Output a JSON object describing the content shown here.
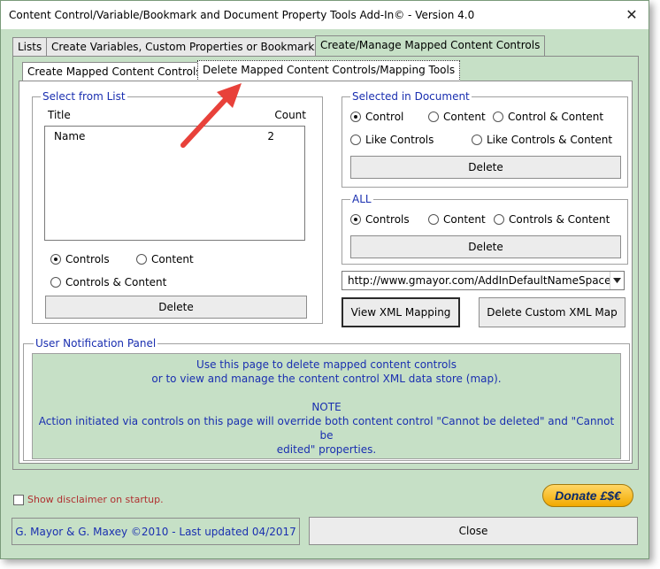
{
  "window": {
    "title": "Content Control/Variable/Bookmark and Document Property Tools Add-In© - Version 4.0",
    "close_glyph": "✕"
  },
  "main_tabs": [
    {
      "label": "Lists"
    },
    {
      "label": "Create Variables, Custom Properties or Bookmarks"
    },
    {
      "label": "Create/Manage Mapped Content Controls"
    }
  ],
  "sub_tabs": [
    {
      "label": "Create Mapped Content Controls"
    },
    {
      "label": "Delete Mapped Content Controls/Mapping Tools"
    }
  ],
  "select_from_list": {
    "legend": "Select from List",
    "col_title": "Title",
    "col_count": "Count",
    "rows": [
      {
        "title": "Name",
        "count": "2"
      }
    ],
    "radio_controls": "Controls",
    "radio_content": "Content",
    "radio_both": "Controls & Content",
    "delete_label": "Delete"
  },
  "selected_in_document": {
    "legend": "Selected in Document",
    "radio_control": "Control",
    "radio_content": "Content",
    "radio_control_content": "Control & Content",
    "radio_like_controls": "Like Controls",
    "radio_like_controls_content": "Like Controls & Content",
    "delete_label": "Delete"
  },
  "all_group": {
    "legend": "ALL",
    "radio_controls": "Controls",
    "radio_content": "Content",
    "radio_both": "Controls & Content",
    "delete_label": "Delete"
  },
  "namespace_select": {
    "value": "http://www.gmayor.com/AddInDefaultNameSpace"
  },
  "view_xml_label": "View XML Mapping",
  "delete_custom_xml_label": "Delete Custom XML Map",
  "notification": {
    "legend": "User Notification Panel",
    "line1": "Use this page to delete mapped content controls",
    "line2": "or to view and manage the content control XML data store (map).",
    "line3": "NOTE",
    "line4": "Action initiated via controls on this page will override both content control \"Cannot be deleted\" and \"Cannot be",
    "line5": "edited\" properties."
  },
  "disclaimer_label": "Show disclaimer on startup.",
  "donate_label": "Donate £$€",
  "credits_label": "G. Mayor & G. Maxey ©2010 - Last updated 04/2017",
  "close_label": "Close",
  "colors": {
    "panel_green": "#c6e0c6",
    "legend_blue": "#1a2fb0",
    "annotation_arrow": "#e8413a"
  }
}
